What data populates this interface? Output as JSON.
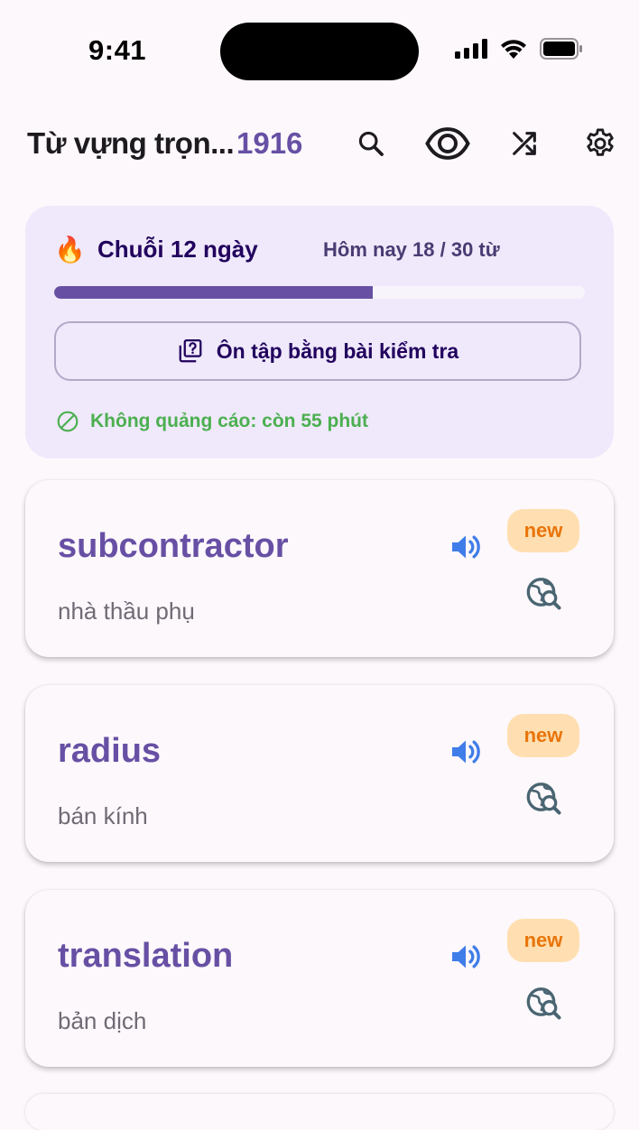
{
  "status_bar": {
    "time": "9:41"
  },
  "header": {
    "title": "Từ vựng trọn...",
    "count": "1916",
    "icons": [
      "search-icon",
      "eye-icon",
      "shuffle-icon",
      "gear-icon"
    ]
  },
  "progress": {
    "streak_emoji": "🔥",
    "streak_label": "Chuỗi 12 ngày",
    "today_label": "Hôm nay 18 / 30 từ",
    "today_done": 18,
    "today_goal": 30,
    "quiz_button_label": "Ôn tập bằng bài kiểm tra",
    "no_ads_label": "Không quảng cáo: còn 55 phút"
  },
  "words": [
    {
      "word": "subcontractor",
      "meaning": "nhà thầu phụ",
      "badge": "new"
    },
    {
      "word": "radius",
      "meaning": "bán kính",
      "badge": "new"
    },
    {
      "word": "translation",
      "meaning": "bản dịch",
      "badge": "new"
    }
  ],
  "colors": {
    "accent": "#6750a4",
    "badge_bg": "#ffdfb1",
    "badge_text": "#e8740a",
    "speaker": "#3f7de8",
    "no_ads": "#4caf50"
  }
}
